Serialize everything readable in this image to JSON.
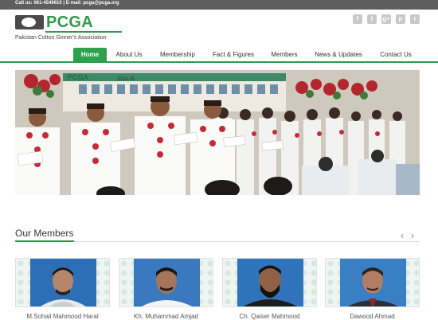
{
  "topbar": {
    "contact": "Call us: 061-4549610 | E-mail: pcga@pcga.org"
  },
  "logo": {
    "name": "PCGA",
    "subtitle": "Pakistan Cotton Ginner's Association"
  },
  "social": [
    {
      "icon": "facebook-icon",
      "glyph": "f"
    },
    {
      "icon": "twitter-icon",
      "glyph": "t"
    },
    {
      "icon": "google-plus-icon",
      "glyph": "g+"
    },
    {
      "icon": "pinterest-icon",
      "glyph": "p"
    },
    {
      "icon": "rss-icon",
      "glyph": "r"
    }
  ],
  "nav": [
    {
      "label": "Home",
      "active": true
    },
    {
      "label": "About Us"
    },
    {
      "label": "Membership"
    },
    {
      "label": "Fact & Figures"
    },
    {
      "label": "Members"
    },
    {
      "label": "News & Updates"
    },
    {
      "label": "Contact Us"
    }
  ],
  "banner": {
    "stage_logo": "PCGA",
    "stage_year": "2014-15"
  },
  "members": {
    "title": "Our Members",
    "items": [
      {
        "name": "M.Sohail Mahmood Haral"
      },
      {
        "name": "Kh. Muhammad Amjad"
      },
      {
        "name": "Ch. Qaiser Mahmood"
      },
      {
        "name": "Dawood Ahmad"
      }
    ]
  },
  "colors": {
    "brand_green": "#2f9a4c",
    "topbar": "#5e5e5e",
    "active_tab": "#2fa04d"
  }
}
